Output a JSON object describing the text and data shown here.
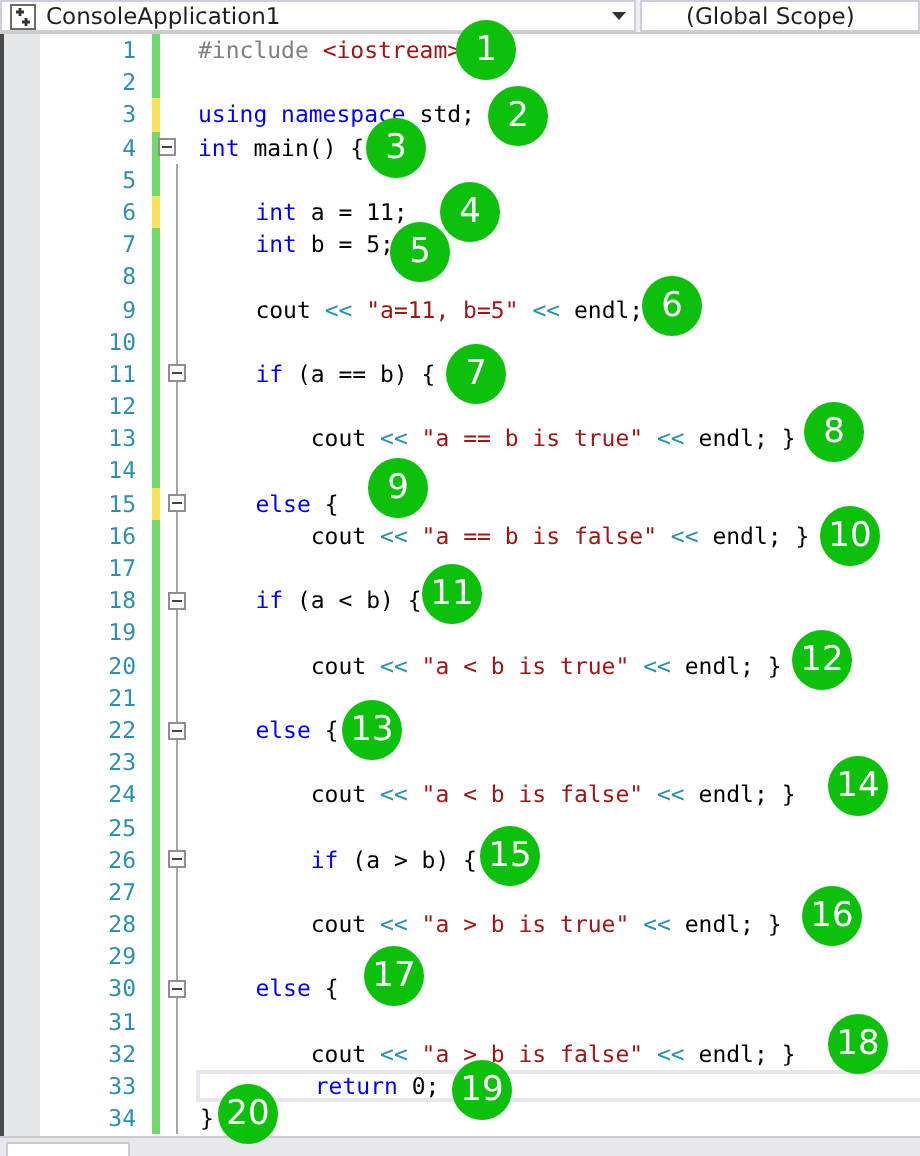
{
  "navigation_bar": {
    "project": "ConsoleApplication1",
    "scope": "(Global Scope)"
  },
  "lines": [
    {
      "number": "1",
      "saved": true,
      "tokens": [
        {
          "kind": "preproc",
          "text": "#include "
        },
        {
          "kind": "string",
          "text": "<iostream>"
        }
      ]
    },
    {
      "number": "2",
      "saved": true
    },
    {
      "number": "3",
      "saved": false,
      "tokens": [
        {
          "kind": "keyword",
          "text": "using namespace"
        },
        {
          "kind": "plain",
          "text": " std;"
        }
      ]
    },
    {
      "number": "4",
      "saved": true,
      "collapsible": true,
      "expanded": true,
      "tokens": [
        {
          "kind": "keyword",
          "text": "int"
        },
        {
          "kind": "plain",
          "text": " main() {"
        }
      ]
    },
    {
      "number": "5",
      "saved": true
    },
    {
      "number": "6",
      "saved": false,
      "tokens": [
        {
          "kind": "keyword",
          "text": "    int"
        },
        {
          "kind": "plain",
          "text": " a = 11;"
        }
      ]
    },
    {
      "number": "7",
      "saved": true,
      "tokens": [
        {
          "kind": "keyword",
          "text": "    int"
        },
        {
          "kind": "plain",
          "text": " b = 5;"
        }
      ]
    },
    {
      "number": "8",
      "saved": true
    },
    {
      "number": "9",
      "saved": true,
      "tokens": [
        {
          "kind": "plain",
          "text": "    cout "
        },
        {
          "kind": "operator",
          "text": "<< "
        },
        {
          "kind": "string",
          "text": "\"a=11, b=5\" "
        },
        {
          "kind": "operator",
          "text": "<<"
        },
        {
          "kind": "plain",
          "text": " endl;"
        }
      ]
    },
    {
      "number": "10",
      "saved": true
    },
    {
      "number": "11",
      "saved": true,
      "collapsible": true,
      "expanded": true,
      "tokens": [
        {
          "kind": "keyword",
          "text": "    if"
        },
        {
          "kind": "plain",
          "text": " (a == b) {"
        }
      ]
    },
    {
      "number": "12",
      "saved": true
    },
    {
      "number": "13",
      "saved": true,
      "tokens": [
        {
          "kind": "plain",
          "text": "        cout "
        },
        {
          "kind": "operator",
          "text": "<< "
        },
        {
          "kind": "string",
          "text": "\"a == b is true\" "
        },
        {
          "kind": "operator",
          "text": "<<"
        },
        {
          "kind": "plain",
          "text": " endl; }"
        }
      ]
    },
    {
      "number": "14",
      "saved": true
    },
    {
      "number": "15",
      "saved": false,
      "collapsible": true,
      "expanded": true,
      "tokens": [
        {
          "kind": "keyword",
          "text": "    else"
        },
        {
          "kind": "plain",
          "text": " {"
        }
      ]
    },
    {
      "number": "16",
      "saved": true,
      "tokens": [
        {
          "kind": "plain",
          "text": "        cout "
        },
        {
          "kind": "operator",
          "text": "<< "
        },
        {
          "kind": "string",
          "text": "\"a == b is false\" "
        },
        {
          "kind": "operator",
          "text": "<<"
        },
        {
          "kind": "plain",
          "text": " endl; }"
        }
      ]
    },
    {
      "number": "17",
      "saved": true
    },
    {
      "number": "18",
      "saved": true,
      "collapsible": true,
      "expanded": true,
      "tokens": [
        {
          "kind": "keyword",
          "text": "    if"
        },
        {
          "kind": "plain",
          "text": " (a < b) {"
        }
      ]
    },
    {
      "number": "19",
      "saved": true
    },
    {
      "number": "20",
      "saved": true,
      "tokens": [
        {
          "kind": "plain",
          "text": "        cout "
        },
        {
          "kind": "operator",
          "text": "<< "
        },
        {
          "kind": "string",
          "text": "\"a < b is true\" "
        },
        {
          "kind": "operator",
          "text": "<<"
        },
        {
          "kind": "plain",
          "text": " endl; }"
        }
      ]
    },
    {
      "number": "21",
      "saved": true
    },
    {
      "number": "22",
      "saved": true,
      "collapsible": true,
      "expanded": true,
      "tokens": [
        {
          "kind": "keyword",
          "text": "    else"
        },
        {
          "kind": "plain",
          "text": " {"
        }
      ]
    },
    {
      "number": "23",
      "saved": true
    },
    {
      "number": "24",
      "saved": true,
      "tokens": [
        {
          "kind": "plain",
          "text": "        cout "
        },
        {
          "kind": "operator",
          "text": "<< "
        },
        {
          "kind": "string",
          "text": "\"a < b is false\" "
        },
        {
          "kind": "operator",
          "text": "<<"
        },
        {
          "kind": "plain",
          "text": " endl; }"
        }
      ]
    },
    {
      "number": "25",
      "saved": true
    },
    {
      "number": "26",
      "saved": true,
      "collapsible": true,
      "expanded": true,
      "tokens": [
        {
          "kind": "keyword",
          "text": "        if"
        },
        {
          "kind": "plain",
          "text": " (a > b) {"
        }
      ]
    },
    {
      "number": "27",
      "saved": true
    },
    {
      "number": "28",
      "saved": true,
      "tokens": [
        {
          "kind": "plain",
          "text": "        cout "
        },
        {
          "kind": "operator",
          "text": "<< "
        },
        {
          "kind": "string",
          "text": "\"a > b is true\" "
        },
        {
          "kind": "operator",
          "text": "<<"
        },
        {
          "kind": "plain",
          "text": " endl; }"
        }
      ]
    },
    {
      "number": "29",
      "saved": true
    },
    {
      "number": "30",
      "saved": true,
      "collapsible": true,
      "expanded": true,
      "tokens": [
        {
          "kind": "keyword",
          "text": "    else"
        },
        {
          "kind": "plain",
          "text": " {"
        }
      ]
    },
    {
      "number": "31",
      "saved": true
    },
    {
      "number": "32",
      "saved": true,
      "tokens": [
        {
          "kind": "plain",
          "text": "        cout "
        },
        {
          "kind": "operator",
          "text": "<< "
        },
        {
          "kind": "string",
          "text": "\"a > b is false\" "
        },
        {
          "kind": "operator",
          "text": "<<"
        },
        {
          "kind": "plain",
          "text": " endl; }"
        }
      ]
    },
    {
      "number": "33",
      "saved": true,
      "current": true,
      "tokens": [
        {
          "kind": "keyword",
          "text": "        return"
        },
        {
          "kind": "plain",
          "text": " 0;"
        }
      ]
    },
    {
      "number": "34",
      "saved": true,
      "tokens": [
        {
          "kind": "plain",
          "text": "}"
        }
      ]
    }
  ],
  "callouts": [
    {
      "text": "1"
    },
    {
      "text": "2"
    },
    {
      "text": "3"
    },
    {
      "text": "4"
    },
    {
      "text": "5"
    },
    {
      "text": "6"
    },
    {
      "text": "7"
    },
    {
      "text": "8"
    },
    {
      "text": "9"
    },
    {
      "text": "10"
    },
    {
      "text": "11"
    },
    {
      "text": "12"
    },
    {
      "text": "13"
    },
    {
      "text": "14"
    },
    {
      "text": "15"
    },
    {
      "text": "16"
    },
    {
      "text": "17"
    },
    {
      "text": "18"
    },
    {
      "text": "19"
    },
    {
      "text": "20"
    }
  ]
}
